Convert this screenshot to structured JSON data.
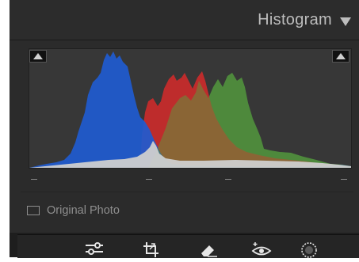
{
  "panel": {
    "title": "Histogram",
    "collapse_icon": "triangle-down-icon",
    "original_photo_label": "Original Photo"
  },
  "histogram": {
    "channels": [
      "blue",
      "red",
      "green",
      "luminance"
    ],
    "colors": {
      "background": "#373737",
      "blue": "#1f5bd0",
      "red": "#d62a2a",
      "green": "#3b9a3b",
      "luminance": "#cfcfcf"
    },
    "shadow_clipping_icon": "triangle-up-icon",
    "highlight_clipping_icon": "triangle-up-icon"
  },
  "toolbar": {
    "tools": [
      "sliders-icon",
      "crop-icon",
      "eraser-icon",
      "red-eye-icon",
      "masking-icon"
    ]
  }
}
